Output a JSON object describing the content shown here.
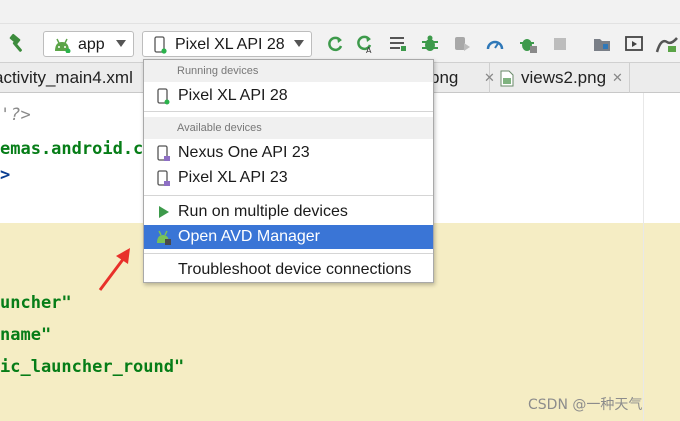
{
  "toolbar": {
    "run_config": {
      "label": "app",
      "icon": "android-icon"
    },
    "device_selector": {
      "label": "Pixel XL API 28",
      "icon": "phone-icon"
    },
    "icons": [
      "hammer-icon",
      "rerun-icon",
      "apply-changes-icon",
      "logcat-icon",
      "debug-icon",
      "attach-debugger-icon",
      "profile-icon",
      "debug-bug-icon",
      "stop-icon",
      "project-structure-icon",
      "avd-manager-icon",
      "sdk-manager-icon"
    ]
  },
  "tabs": [
    {
      "label": "activity_main4.xml"
    },
    {
      "label": "png"
    },
    {
      "label": "views2.png"
    }
  ],
  "code_lines": [
    {
      "text": "'?>"
    },
    {
      "text": "emas.android.co"
    },
    {
      "text": ">"
    },
    {
      "text": "uncher\""
    },
    {
      "text": "name\""
    },
    {
      "text": "ic_launcher_round\""
    }
  ],
  "dropdown": {
    "running_header": "Running devices",
    "running_devices": [
      {
        "label": "Pixel XL API 28",
        "icon": "running-phone-icon"
      }
    ],
    "available_header": "Available devices",
    "available_devices": [
      {
        "label": "Nexus One API 23",
        "icon": "phone-icon"
      },
      {
        "label": "Pixel XL API 23",
        "icon": "phone-icon"
      }
    ],
    "actions": [
      {
        "label": "Run on multiple devices",
        "icon": "run-icon"
      },
      {
        "label": "Open AVD Manager",
        "icon": "avd-manager-icon",
        "selected": true
      }
    ],
    "troubleshoot": {
      "label": "Troubleshoot device connections"
    }
  },
  "annotation": {
    "icon": "red-arrow-icon",
    "color": "#e8312a"
  },
  "watermark": {
    "text": "CSDN @一种天气"
  },
  "colors": {
    "selection": "#3a75d6",
    "code_string": "#067d17",
    "highlight_band": "#f5edc4",
    "run_green": "#3d9a4b",
    "android_green": "#5ba447"
  }
}
